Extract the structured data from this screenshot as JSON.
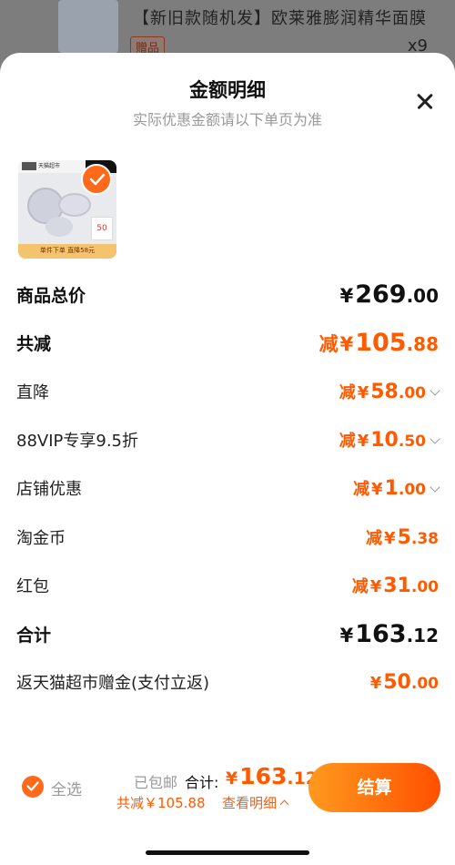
{
  "background_item": {
    "title": "【新旧款随机发】欧莱雅膨润精华面膜",
    "tag": "赠品",
    "quantity": "x9"
  },
  "sheet": {
    "title": "金额明细",
    "subtitle": "实际优惠金额请以下单页为准"
  },
  "product": {
    "store_label": "天猫超市",
    "caption": "单件下单 直降58元",
    "card_text": "50"
  },
  "rows": [
    {
      "label": "商品总价",
      "prefix": "",
      "currency": "¥",
      "int": "269",
      "dec": ".00",
      "color": "#111111",
      "expandable": false
    },
    {
      "label": "共减",
      "prefix": "减",
      "currency": "¥",
      "int": "105",
      "dec": ".88",
      "color": "#ff5a00",
      "expandable": false
    },
    {
      "label": "直降",
      "prefix": "减",
      "currency": "¥",
      "int": "58",
      "dec": ".00",
      "color": "#ff5a00",
      "expandable": true
    },
    {
      "label": "88VIP专享9.5折",
      "prefix": "减",
      "currency": "¥",
      "int": "10",
      "dec": ".50",
      "color": "#ff5a00",
      "expandable": true
    },
    {
      "label": "店铺优惠",
      "prefix": "减",
      "currency": "¥",
      "int": "1",
      "dec": ".00",
      "color": "#ff5a00",
      "expandable": true
    },
    {
      "label": "淘金币",
      "prefix": "减",
      "currency": "¥",
      "int": "5",
      "dec": ".38",
      "color": "#ff5a00",
      "expandable": false
    },
    {
      "label": "红包",
      "prefix": "减",
      "currency": "¥",
      "int": "31",
      "dec": ".00",
      "color": "#ff5a00",
      "expandable": false
    },
    {
      "label": "合计",
      "prefix": "",
      "currency": "¥",
      "int": "163",
      "dec": ".12",
      "color": "#111111",
      "expandable": false
    },
    {
      "label": "返天猫超市赠金(支付立返)",
      "prefix": "",
      "currency": "¥",
      "int": "50",
      "dec": ".00",
      "color": "#ff5a00",
      "expandable": false
    }
  ],
  "bottom_bar": {
    "select_all": "全选",
    "shipping": "已包邮",
    "total_label": "合计:",
    "total_currency": "¥",
    "total_int": "163",
    "total_dec": ".12",
    "discount": "共减￥105.88",
    "detail_link": "查看明细",
    "checkout": "结算"
  },
  "colors": {
    "accent": "#ff5a00",
    "checkout_gradient_start": "#ff9a1e",
    "checkout_gradient_end": "#ff5000"
  }
}
